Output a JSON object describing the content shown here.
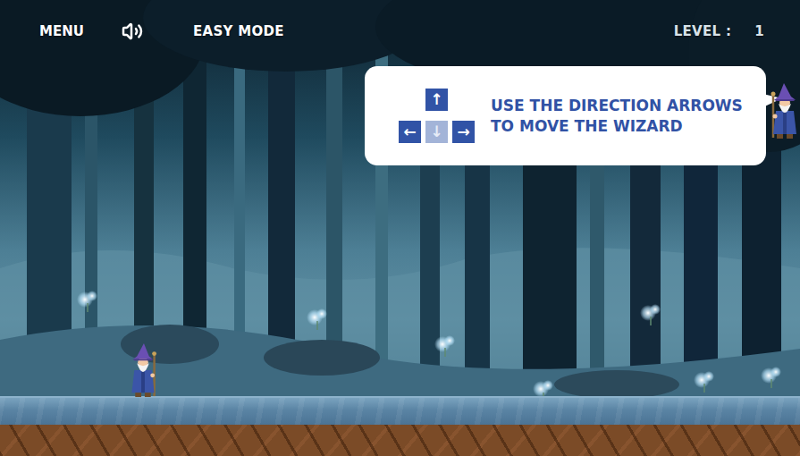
{
  "top_bar": {
    "menu": "MENU",
    "sound": {
      "on": true
    },
    "mode": "EASY MODE",
    "level_label": "LEVEL :",
    "level": "1"
  },
  "hint": {
    "keys": [
      {
        "label": "↑",
        "kind": "up",
        "disabled": false
      },
      {
        "label": "←",
        "kind": "left",
        "disabled": false
      },
      {
        "label": "↓",
        "kind": "down",
        "disabled": true
      },
      {
        "label": "→",
        "kind": "right",
        "disabled": false
      }
    ],
    "lines": [
      "USE THE DIRECTION ARROWS",
      "TO MOVE THE WIZARD"
    ]
  }
}
